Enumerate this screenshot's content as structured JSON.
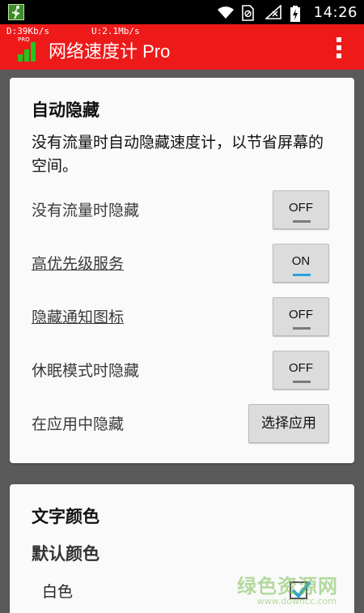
{
  "status_bar": {
    "time": "14:26"
  },
  "app_bar": {
    "download_speed": "D:39Kb/s",
    "upload_speed": "U:2.1Mb/s",
    "badge": "PRO",
    "title": "网络速度计 Pro"
  },
  "auto_hide": {
    "title": "自动隐藏",
    "description": "没有流量时自动隐藏速度计，以节省屏幕的空间。",
    "rows": [
      {
        "label": "没有流量时隐藏",
        "state": "OFF"
      },
      {
        "label": "高优先级服务",
        "state": "ON"
      },
      {
        "label": "隐藏通知图标",
        "state": "OFF"
      },
      {
        "label": "休眠模式时隐藏",
        "state": "OFF"
      }
    ],
    "app_hide_label": "在应用中隐藏",
    "select_app_button": "选择应用"
  },
  "text_color": {
    "title": "文字颜色",
    "default_color_title": "默认颜色",
    "option_label": "白色",
    "option_checked": true
  },
  "watermark": {
    "text": "绿色资源网",
    "url": "www.downcc.com"
  },
  "colors": {
    "app_bar": "#ee1a1a",
    "toggle_on_indicator": "#2aa3e0",
    "signal_bars": "#22c41e"
  }
}
